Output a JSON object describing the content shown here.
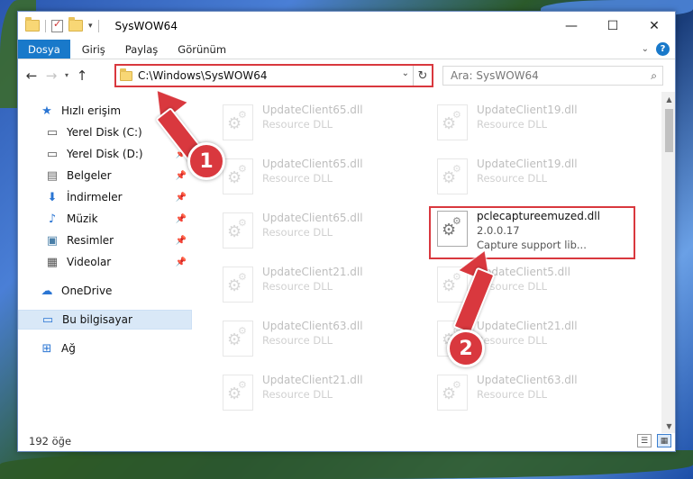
{
  "window": {
    "title": "SysWOW64"
  },
  "ribbon": {
    "tabs": [
      "Dosya",
      "Giriş",
      "Paylaş",
      "Görünüm"
    ]
  },
  "nav": {
    "address": "C:\\Windows\\SysWOW64",
    "search_placeholder": "Ara: SysWOW64"
  },
  "sidebar": {
    "items": [
      {
        "label": "Hızlı erişim",
        "icon": "star-icon"
      },
      {
        "label": "Yerel Disk (C:)",
        "icon": "drive-icon"
      },
      {
        "label": "Yerel Disk (D:)",
        "icon": "drive-icon"
      },
      {
        "label": "Belgeler",
        "icon": "document-icon"
      },
      {
        "label": "İndirmeler",
        "icon": "download-icon"
      },
      {
        "label": "Müzik",
        "icon": "music-icon"
      },
      {
        "label": "Resimler",
        "icon": "pictures-icon"
      },
      {
        "label": "Videolar",
        "icon": "video-icon"
      },
      {
        "label": "OneDrive",
        "icon": "cloud-icon"
      },
      {
        "label": "Bu bilgisayar",
        "icon": "computer-icon"
      },
      {
        "label": "Ağ",
        "icon": "network-icon"
      }
    ]
  },
  "files": {
    "col1": [
      {
        "name": "UpdateClient65.dll",
        "sub": "Resource DLL"
      },
      {
        "name": "UpdateClient65.dll",
        "sub": "Resource DLL"
      },
      {
        "name": "UpdateClient65.dll",
        "sub": "Resource DLL"
      },
      {
        "name": "UpdateClient21.dll",
        "sub": "Resource DLL"
      },
      {
        "name": "UpdateClient63.dll",
        "sub": "Resource DLL"
      },
      {
        "name": "UpdateClient21.dll",
        "sub": "Resource DLL"
      }
    ],
    "col2": [
      {
        "name": "UpdateClient19.dll",
        "sub": "Resource DLL"
      },
      {
        "name": "UpdateClient19.dll",
        "sub": "Resource DLL"
      },
      {
        "name": "UpdateClient5.dll",
        "sub": "Resource DLL"
      },
      {
        "name": "UpdateClient21.dll",
        "sub": "Resource DLL"
      },
      {
        "name": "UpdateClient63.dll",
        "sub": "Resource DLL"
      }
    ],
    "highlighted": {
      "name": "pclecaptureemuzed.dll",
      "version": "2.0.0.17",
      "description": "Capture support lib..."
    }
  },
  "status": {
    "count": "192 öğe"
  },
  "annotations": {
    "step1": "1",
    "step2": "2"
  },
  "colors": {
    "accent": "#1979ca",
    "highlight": "#d9383e"
  }
}
